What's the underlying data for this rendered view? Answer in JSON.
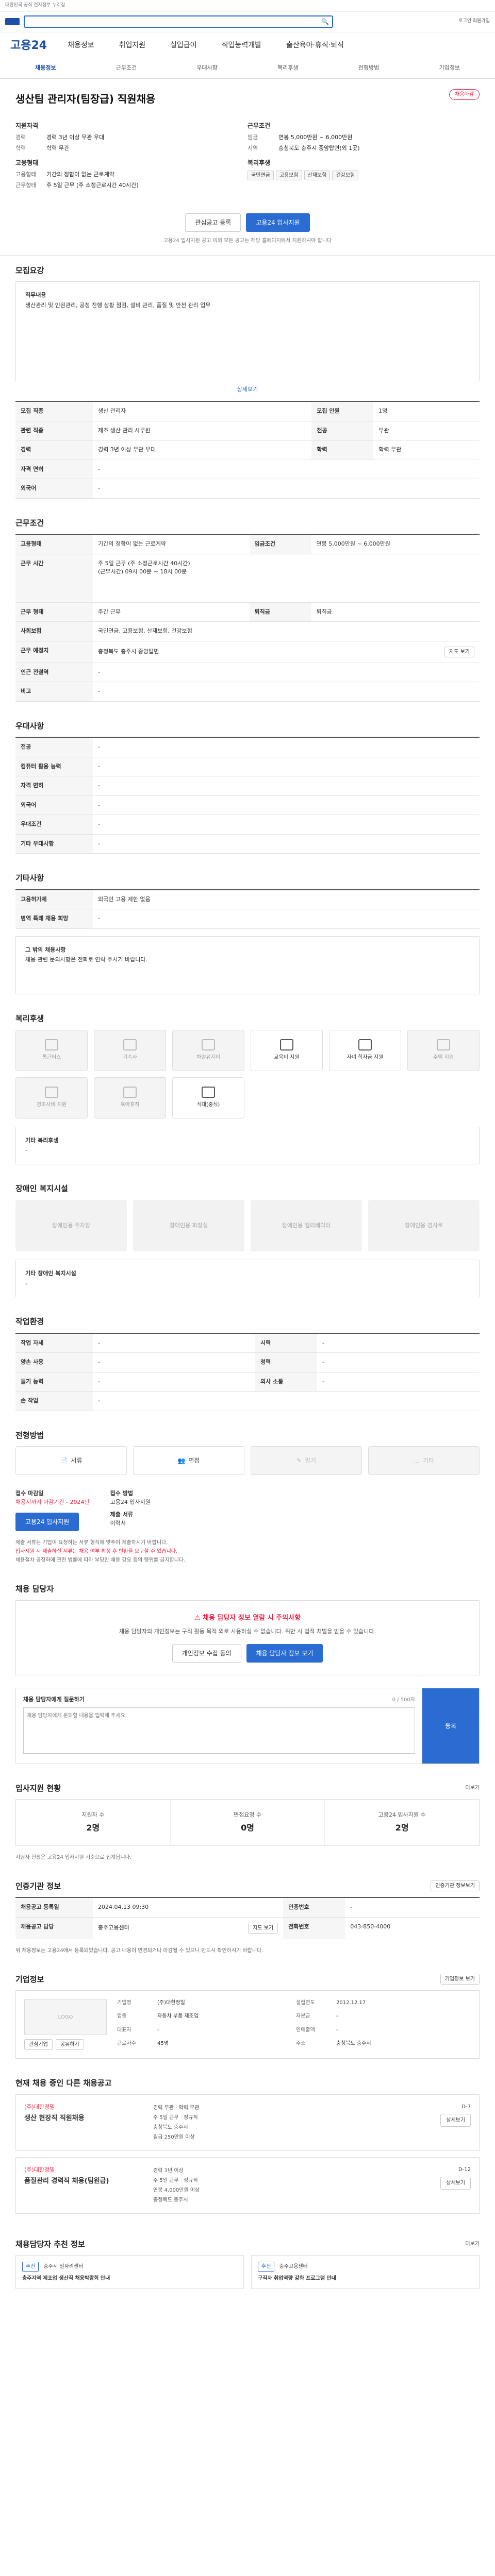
{
  "top": {
    "notice": "대한민국 공식 전자정부 누리집",
    "search_placeholder": "",
    "util": "로그인 회원가입"
  },
  "gnb": {
    "brand": "고용24",
    "menu": [
      "채용정보",
      "취업지원",
      "실업급여",
      "직업능력개발",
      "출산육아·휴직·퇴직"
    ]
  },
  "tabs": [
    "채용정보",
    "근무조건",
    "우대사항",
    "복리후생",
    "전형방법",
    "기업정보"
  ],
  "job": {
    "status": "채용마감",
    "title": "생산팀 관리자(팀장급) 직원채용",
    "exp_h": "지원자격",
    "exp_rows": [
      {
        "k": "경력",
        "v": "경력 3년 이상 무관 우대"
      },
      {
        "k": "학력",
        "v": "학력 무관"
      }
    ],
    "cond_h": "근무조건",
    "cond_rows": [
      {
        "k": "임금",
        "v": "연봉 5,000만원 ~ 6,000만원"
      },
      {
        "k": "지역",
        "v": "충청북도 충주시 중앙탑면(외 1곳)"
      }
    ],
    "employ_h": "고용형태",
    "employ_rows": [
      {
        "k": "고용형태",
        "v": "기간의 정함이 없는 근로계약"
      },
      {
        "k": "근무형태",
        "v": "주 5일 근무 (주 소정근로시간 40시간)"
      }
    ],
    "welfare_h": "복리후생",
    "welfare_chips": [
      "국민연금",
      "고용보험",
      "산재보험",
      "건강보험"
    ],
    "btn_scrap": "관심공고 등록",
    "btn_apply": "고용24 입사지원",
    "cta_note": "고용24 입사지원 공고 이외 모든 공고는 해당 홈페이지에서 지원하셔야 합니다"
  },
  "s_recruit": {
    "title": "모집요강",
    "duty_title": "직무내용",
    "duty": "생산관리 및 인원관리, 공정 진행 상황 점검, 설비 관리, 품질 및 안전 관리 업무",
    "detail_link": "상세보기",
    "rows": [
      {
        "k": "모집 직종",
        "v": "생산 관리자"
      },
      {
        "k": "모집 인원",
        "v": "1명"
      },
      {
        "k": "관련 직종",
        "v": "제조 생산 관리 사무원"
      },
      {
        "k": "전공",
        "v": "무관"
      },
      {
        "k": "경력",
        "v": "경력 3년 이상 무관 우대"
      },
      {
        "k": "학력",
        "v": "학력 무관"
      },
      {
        "k": "자격 면허",
        "v": "-"
      },
      {
        "k": "외국어",
        "v": "-"
      }
    ]
  },
  "s_cond": {
    "title": "근무조건",
    "rows": [
      {
        "k": "고용형태",
        "v": "기간의 정함이 없는 근로계약"
      },
      {
        "k": "임금조건",
        "v": "연봉 5,000만원 ~ 6,000만원"
      },
      {
        "k": "근무 시간",
        "v": "주 5일 근무 (주 소정근로시간 40시간)"
      },
      {
        "k": "근무 형태",
        "v": "주간 근무"
      },
      {
        "k": "퇴직금",
        "v": "퇴직금"
      },
      {
        "k": "사회보험",
        "v": "국민연금, 고용보험, 산재보험, 건강보험"
      },
      {
        "k": "근무 예정지",
        "v": "충청북도 충주시 중앙탑면"
      },
      {
        "k": "인근 전철역",
        "v": "-"
      },
      {
        "k": "비고",
        "v": "-"
      }
    ],
    "work_time": "(근무시간) 09시 00분 ~ 18시 00분",
    "map_btn": "지도 보기"
  },
  "s_pref": {
    "title": "우대사항",
    "rows": [
      {
        "k": "전공",
        "v": "-"
      },
      {
        "k": "컴퓨터 활용 능력",
        "v": "-"
      },
      {
        "k": "자격 면허",
        "v": "-"
      },
      {
        "k": "외국어",
        "v": "-"
      },
      {
        "k": "우대조건",
        "v": "-"
      },
      {
        "k": "기타 우대사항",
        "v": "-"
      }
    ]
  },
  "s_extra": {
    "title": "기타사항",
    "rows": [
      {
        "k": "고용허가제",
        "v": "외국인 고용 제한 없음"
      },
      {
        "k": "병역 특례 채용 희망",
        "v": "-"
      }
    ],
    "box_h": "그 밖의 채용사항",
    "box": "채용 관련 문의사항은 전화로 연락 주시기 바랍니다."
  },
  "s_welfare": {
    "title": "복리후생",
    "items": [
      {
        "label": "통근버스",
        "on": false
      },
      {
        "label": "기숙사",
        "on": false
      },
      {
        "label": "차량유지비",
        "on": false
      },
      {
        "label": "교육비 지원",
        "on": true
      },
      {
        "label": "자녀 학자금 지원",
        "on": true
      },
      {
        "label": "주택 지원",
        "on": false
      },
      {
        "label": "경조사비 지원",
        "on": false
      },
      {
        "label": "육아휴직",
        "on": false
      },
      {
        "label": "식대(중식)",
        "on": true
      }
    ],
    "etc_h": "기타 복리후생",
    "etc": "-"
  },
  "s_disab": {
    "title": "장애인 복지시설",
    "items": [
      "장애인용 주차장",
      "장애인용 화장실",
      "장애인용 엘리베이터",
      "장애인용 경사로"
    ],
    "etc_h": "기타 장애인 복지시설",
    "etc": "-"
  },
  "s_env": {
    "title": "작업환경",
    "rows_l": [
      {
        "k": "작업 자세",
        "v": "-"
      },
      {
        "k": "양손 사용",
        "v": "-"
      },
      {
        "k": "들기 능력",
        "v": "-"
      },
      {
        "k": "손 작업",
        "v": "-"
      }
    ],
    "rows_r": [
      {
        "k": "시력",
        "v": "-"
      },
      {
        "k": "청력",
        "v": "-"
      },
      {
        "k": "의사 소통",
        "v": "-"
      }
    ]
  },
  "s_method": {
    "title": "전형방법",
    "pills": [
      {
        "label": "서류",
        "on": true
      },
      {
        "label": "면접",
        "on": true
      },
      {
        "label": "필기",
        "on": false
      },
      {
        "label": "기타",
        "on": false
      }
    ],
    "deadline_l": "접수 마감일",
    "deadline_v": "채용시까지 마감기간 - 2024년",
    "method_l": "접수 방법",
    "method_v": "고용24 입사지원",
    "apply_btn": "고용24 입사지원",
    "docs_l": "제출 서류",
    "docs_v": "이력서",
    "notes": [
      "제출 서류는 기업이 요청하는 서류 형식에 맞추어 제출하시기 바랍니다.",
      "입사지원 시 제출하신 서류는 채용 여부 확정 후 반환을 요구할 수 있습니다.",
      "채용절차 공정화에 관한 법률에 따라 부당한 채용 강요 등의 행위를 금지합니다."
    ]
  },
  "s_warn": {
    "title": "채용 담당자",
    "warn_title": "채용 담당자 정보 열람 시 주의사항",
    "warn_text": "채용 담당자의 개인정보는 구직 활동 목적 외로 사용하실 수 없습니다. 위반 시 법적 처벌을 받을 수 있습니다.",
    "btn_l": "개인정보 수집 동의",
    "btn_r": "채용 담당자 정보 보기",
    "qa_h": "채용 담당자에게 질문하기",
    "qa_limit": "0 / 500자",
    "qa_placeholder": "채용 담당자에게 문의할 내용을 입력해 주세요.",
    "qa_btn": "등록"
  },
  "s_stat": {
    "title": "입사지원 현황",
    "more": "더보기",
    "stats": [
      {
        "l": "지원자 수",
        "v": "2명"
      },
      {
        "l": "면접요청 수",
        "v": "0명"
      },
      {
        "l": "고용24 입사지원 수",
        "v": "2명"
      }
    ],
    "note": "지원자 현황은 고용24 입사지원 기준으로 집계됩니다."
  },
  "s_info": {
    "title": "인증기관 정보",
    "btn": "인증기관 정보보기",
    "rows": [
      {
        "k": "채용공고 등록일",
        "v": "2024.04.13 09:30"
      },
      {
        "k": "인증번호",
        "v": "-"
      },
      {
        "k": "채용공고 담당",
        "v": "충주고용센터"
      },
      {
        "k": "전화번호",
        "v": "043-850-4000"
      }
    ],
    "map_btn": "지도 보기",
    "note": "위 채용정보는 고용24에서 등록되었습니다. 공고 내용이 변경되거나 마감될 수 있으니 반드시 확인하시기 바랍니다."
  },
  "s_company": {
    "title": "기업정보",
    "btn_more": "기업정보 보기",
    "logo_alt": "LOGO",
    "btn_a": "관심기업",
    "btn_b": "공유하기",
    "rows": [
      {
        "k": "기업명",
        "v": "(주)대한정밀"
      },
      {
        "k": "업종",
        "v": "자동차 부품 제조업"
      },
      {
        "k": "대표자",
        "v": "-"
      },
      {
        "k": "근로자수",
        "v": "45명"
      },
      {
        "k": "설립연도",
        "v": "2012.12.17"
      },
      {
        "k": "자본금",
        "v": "-"
      },
      {
        "k": "연매출액",
        "v": "-"
      },
      {
        "k": "주소",
        "v": "충청북도 충주시"
      }
    ]
  },
  "s_same": {
    "title": "현재 채용 중인 다른 채용공고",
    "cards": [
      {
        "company": "(주)대한정밀",
        "title": "생산 현장직 직원채용",
        "lines": [
          "경력 무관 · 학력 무관",
          "주 5일 근무 · 정규직",
          "충청북도 충주시"
        ],
        "salary": "월급 250만원 이상",
        "dday": "D-7",
        "btn": "상세보기"
      },
      {
        "company": "(주)대한정밀",
        "title": "품질관리 경력직 채용(팀원급)",
        "lines": [
          "경력 3년 이상",
          "주 5일 근무 · 정규직",
          "연봉 4,000만원 이상"
        ],
        "salary": "충청북도 충주시",
        "dday": "D-12",
        "btn": "상세보기"
      }
    ]
  },
  "s_rec": {
    "title": "채용담당자 추천 정보",
    "more": "더보기",
    "cards": [
      {
        "tag": "추천",
        "org": "충주시 일자리센터",
        "text": "충주지역 제조업 생산직 채용박람회 안내"
      },
      {
        "tag": "추천",
        "org": "충주고용센터",
        "text": "구직자 취업역량 강화 프로그램 안내"
      }
    ]
  },
  "colors": {
    "accent": "#2b6cd3",
    "brand": "#1e4fa8",
    "alert": "#ee2244"
  }
}
